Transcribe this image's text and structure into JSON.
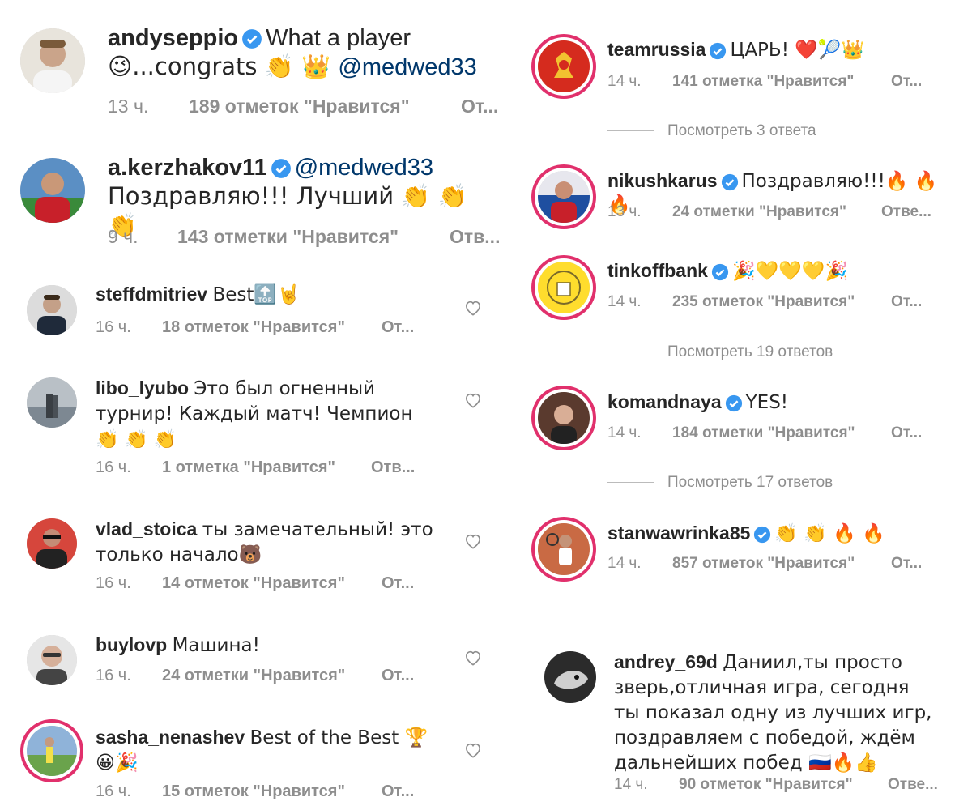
{
  "left": [
    {
      "user": "andyseppio",
      "verified": true,
      "text_a": "What a player",
      "text_b": "😉...congrats 👏 👑 ",
      "mention": "@medwed33",
      "time": "13 ч.",
      "likes": "189 отметок \"Нравится\"",
      "reply": "От..."
    },
    {
      "user": "a.kerzhakov11",
      "verified": true,
      "mention": "@medwed33",
      "text_b": "Поздравляю!!! Лучший 👏 👏 👏",
      "time": "9 ч.",
      "likes": "143 отметки \"Нравится\"",
      "reply": "Отв..."
    },
    {
      "user": "steffdmitriev",
      "text": "Best🔝🤘",
      "time": "16 ч.",
      "likes": "18 отметок \"Нравится\"",
      "reply": "От..."
    },
    {
      "user": "libo_lyubo",
      "text": "Это был огненный турнир! Каждый матч! Чемпион👏 👏 👏",
      "time": "16 ч.",
      "likes": "1 отметка \"Нравится\"",
      "reply": "Отв..."
    },
    {
      "user": "vlad_stoica",
      "text": "ты замечательный! это только начало🐻",
      "time": "16 ч.",
      "likes": "14 отметок \"Нравится\"",
      "reply": "От..."
    },
    {
      "user": "buylovp",
      "text": "Машина!",
      "time": "16 ч.",
      "likes": "24 отметки \"Нравится\"",
      "reply": "От..."
    },
    {
      "user": "sasha_nenashev",
      "text": "Best of the Best 🏆 😀🎉",
      "time": "16 ч.",
      "likes": "15 отметок \"Нравится\"",
      "reply": "От..."
    }
  ],
  "right": [
    {
      "user": "teamrussia",
      "verified": true,
      "text": "ЦАРЬ! ❤️🎾👑",
      "time": "14 ч.",
      "likes": "141 отметка \"Нравится\"",
      "reply": "От...",
      "view_replies": "Посмотреть 3 ответа"
    },
    {
      "user": "nikushkarus",
      "verified": true,
      "text": "Поздравляю!!!🔥 🔥 🔥",
      "time": "13 ч.",
      "likes": "24 отметки \"Нравится\"",
      "reply": "Отве..."
    },
    {
      "user": "tinkoffbank",
      "verified": true,
      "text": "🎉💛💛💛🎉",
      "time": "14 ч.",
      "likes": "235 отметок \"Нравится\"",
      "reply": "От...",
      "view_replies": "Посмотреть 19 ответов"
    },
    {
      "user": "komandnaya",
      "verified": true,
      "text": "YES!",
      "time": "14 ч.",
      "likes": "184 отметки \"Нравится\"",
      "reply": "От...",
      "view_replies": "Посмотреть 17 ответов"
    },
    {
      "user": "stanwawrinka85",
      "verified": true,
      "text": "👏 👏 🔥 🔥",
      "time": "14 ч.",
      "likes": "857 отметок \"Нравится\"",
      "reply": "От..."
    },
    {
      "user": "andrey_69d",
      "text": "Даниил,ты просто зверь,отличная игра, сегодня ты показал одну из лучших игр, поздравляем с победой, ждём дальнейших побед 🇷🇺🔥👍",
      "time": "14 ч.",
      "likes": "90 отметок \"Нравится\"",
      "reply": "Отве..."
    }
  ],
  "colors": {
    "verified": "#3897f0",
    "meta": "#8e8e8e",
    "ring": "#e1306c",
    "mention": "#00376b"
  },
  "icons": {
    "verified": "verified-badge-icon",
    "heart": "heart-outline-icon"
  }
}
